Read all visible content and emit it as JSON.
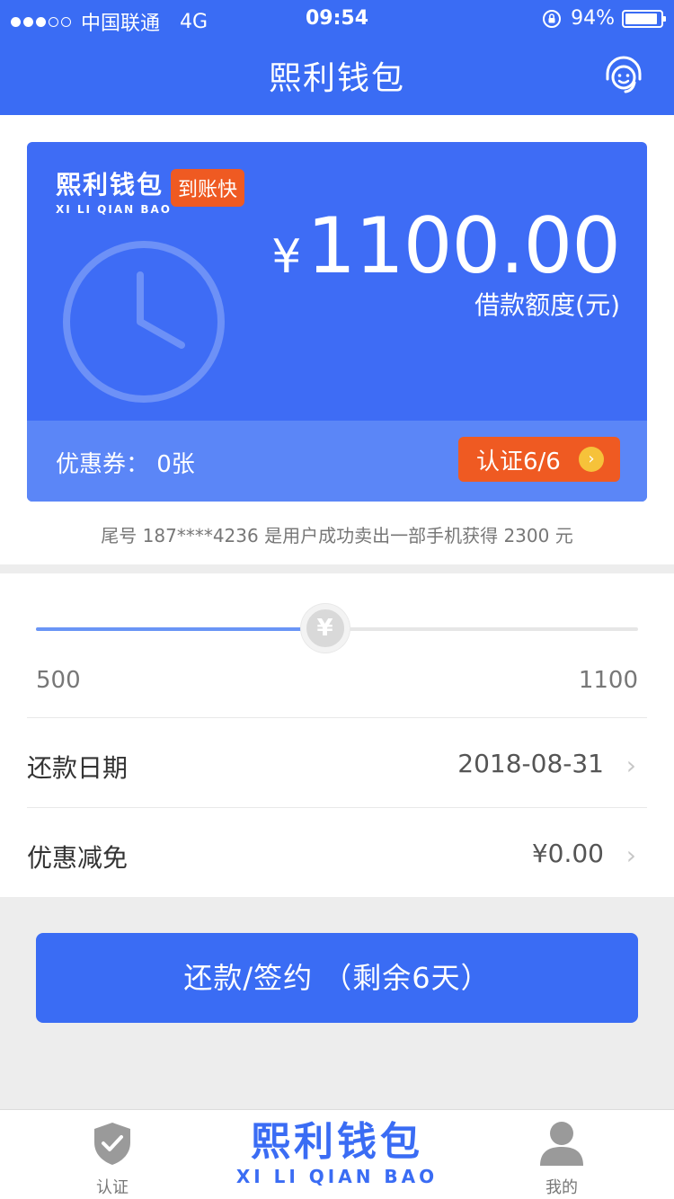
{
  "status": {
    "carrier": "中国联通",
    "network": "4G",
    "time": "09:54",
    "battery": "94%"
  },
  "header": {
    "title": "熙利钱包"
  },
  "card": {
    "brand_cn": "熙利钱包",
    "brand_en": "XI LI QIAN BAO",
    "badge": "到账快",
    "currency": "¥",
    "amount": "1100.00",
    "amount_label": "借款额度(元)",
    "coupon": "优惠券： 0张",
    "verify_label": "认证6/6"
  },
  "ticker": "尾号 187****4236 是用户成功卖出一部手机获得 2300 元",
  "slider": {
    "min": "500",
    "max": "1100",
    "thumb_symbol": "¥",
    "level": 0.48
  },
  "rows": [
    {
      "label": "还款日期",
      "value": "2018-08-31"
    },
    {
      "label": "优惠减免",
      "value": "¥0.00"
    }
  ],
  "action": {
    "label": "还款/签约  （剩余6天）"
  },
  "tabbar": {
    "left": "认证",
    "logo_cn": "熙利钱包",
    "logo_en": "XI LI QIAN BAO",
    "right": "我的"
  },
  "colors": {
    "primary": "#3a6cf4",
    "accent": "#ef5a22"
  }
}
